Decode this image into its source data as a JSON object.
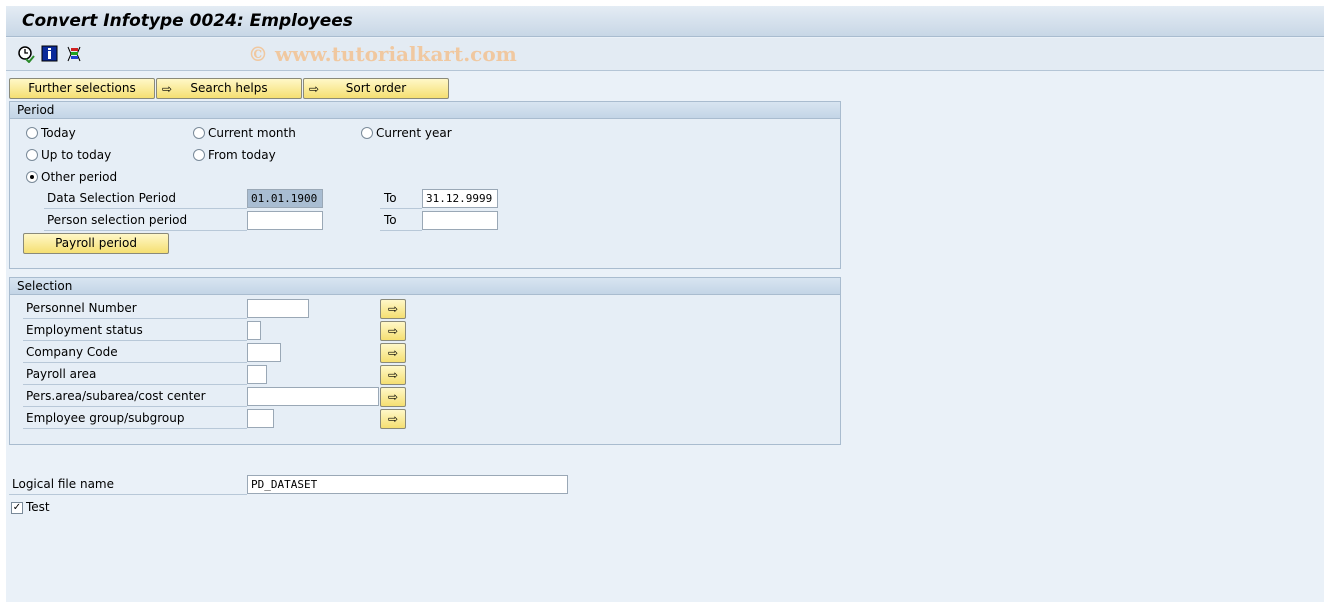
{
  "title": "Convert Infotype 0024: Employees",
  "watermark": "© www.tutorialkart.com",
  "toolbar": {
    "icons": [
      "execute-clock-icon",
      "info-icon",
      "variant-icon"
    ]
  },
  "buttons": {
    "further": "Further selections",
    "search": "Search helps",
    "sort": "Sort order"
  },
  "period": {
    "title": "Period",
    "radios": [
      {
        "label": "Today",
        "checked": false
      },
      {
        "label": "Current month",
        "checked": false
      },
      {
        "label": "Current year",
        "checked": false
      },
      {
        "label": "Up to today",
        "checked": false
      },
      {
        "label": "From today",
        "checked": false
      },
      {
        "label": "Other period",
        "checked": true
      }
    ],
    "data_sel_label": "Data Selection Period",
    "data_from": "01.01.1900",
    "to1": "To",
    "data_to": "31.12.9999",
    "person_sel_label": "Person selection period",
    "person_from": "",
    "to2": "To",
    "person_to": "",
    "payroll_btn": "Payroll period"
  },
  "selection": {
    "title": "Selection",
    "rows": [
      {
        "label": "Personnel Number",
        "value": ""
      },
      {
        "label": "Employment status",
        "value": ""
      },
      {
        "label": "Company Code",
        "value": ""
      },
      {
        "label": "Payroll area",
        "value": ""
      },
      {
        "label": "Pers.area/subarea/cost center",
        "value": ""
      },
      {
        "label": "Employee group/subgroup",
        "value": ""
      }
    ]
  },
  "logical": {
    "label": "Logical file name",
    "value": "PD_DATASET"
  },
  "test": {
    "label": "Test",
    "checked": true
  }
}
